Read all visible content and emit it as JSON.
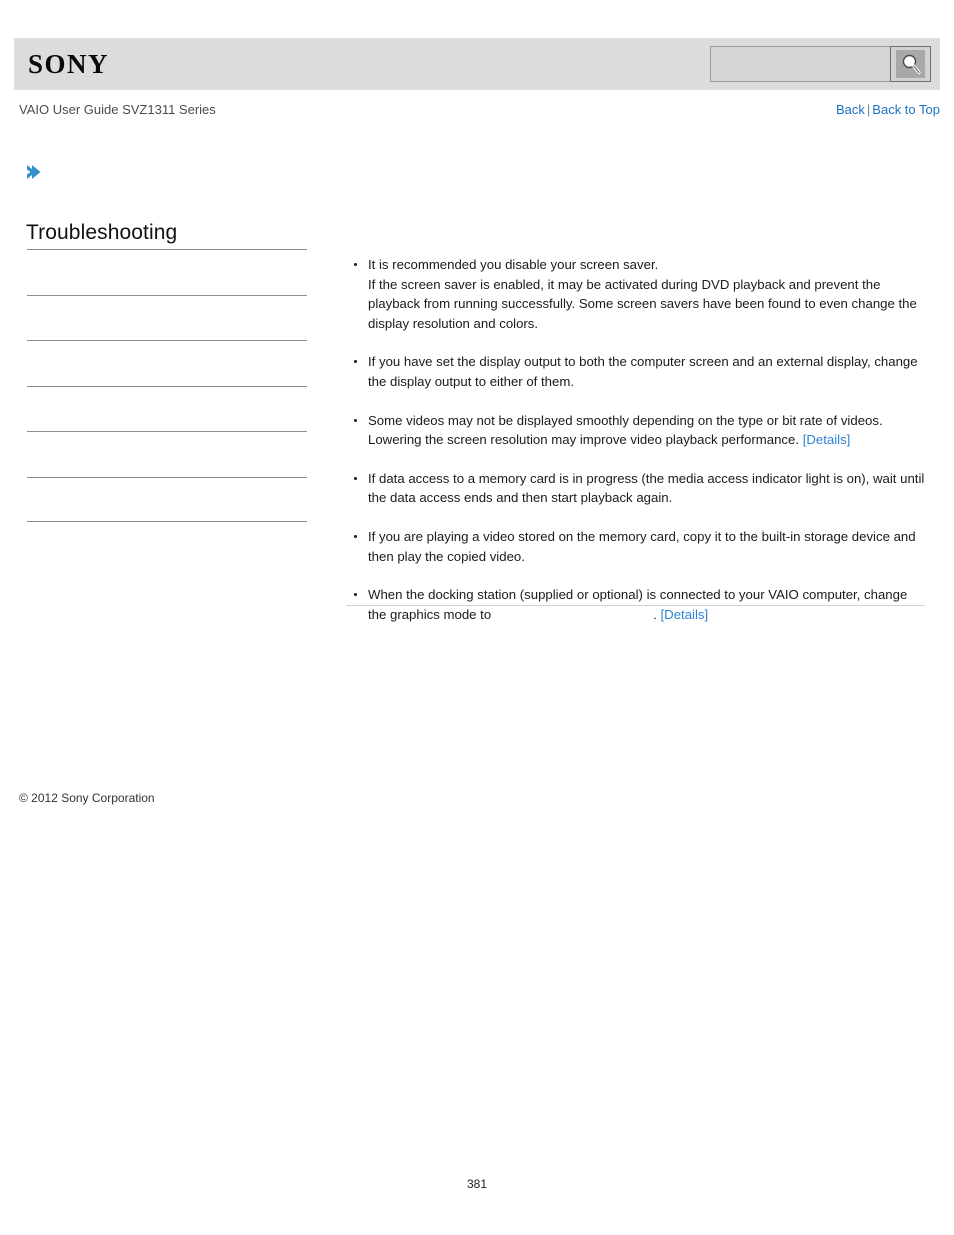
{
  "header": {
    "logo_text": "SONY",
    "search": {
      "value": "",
      "placeholder": "",
      "icon": "search-icon",
      "button_label": ""
    }
  },
  "sub_header": {
    "guide_title": "VAIO User Guide SVZ1311 Series",
    "links": {
      "back": "Back",
      "separator": "|",
      "back_to_top": "Back to Top"
    }
  },
  "sidebar": {
    "breadcrumb_icon": "chevron-right-icon",
    "section_title": "Troubleshooting",
    "items": [
      {
        "label": ""
      },
      {
        "label": ""
      },
      {
        "label": ""
      },
      {
        "label": ""
      },
      {
        "label": ""
      },
      {
        "label": ""
      }
    ],
    "copyright": "© 2012 Sony Corporation"
  },
  "main": {
    "bullets": [
      {
        "lines": [
          "It is recommended you disable your screen saver.",
          "If the screen saver is enabled, it may be activated during DVD playback and prevent the playback from running successfully. Some screen savers have been found to even change the display resolution and colors."
        ],
        "link": ""
      },
      {
        "lines": [
          "If you have set the display output to both the computer screen and an external display, change the display output to either of them."
        ],
        "link": ""
      },
      {
        "lines": [
          "Some videos may not be displayed smoothly depending on the type or bit rate of videos. Lowering the screen resolution may improve video playback performance."
        ],
        "link": "[Details]"
      },
      {
        "lines": [
          "If data access to a memory card is in progress (the media access indicator light is on), wait until the data access ends and then start playback again."
        ],
        "link": ""
      },
      {
        "lines": [
          "If you are playing a video stored on the memory card, copy it to the built-in storage device and then play the copied video."
        ],
        "link": ""
      },
      {
        "lines": [
          "When the docking station (supplied or optional) is connected to your VAIO computer, change the graphics mode to"
        ],
        "trailing_text": ".",
        "link": "[Details]"
      }
    ]
  },
  "footer": {
    "page_number": "381"
  },
  "colors": {
    "header_bg": "#dcdcdc",
    "link_blue": "#1a72c4",
    "details_blue": "#2f83d4",
    "arrow_blue": "#3390cc",
    "rule_gray": "#8d8d8d"
  }
}
